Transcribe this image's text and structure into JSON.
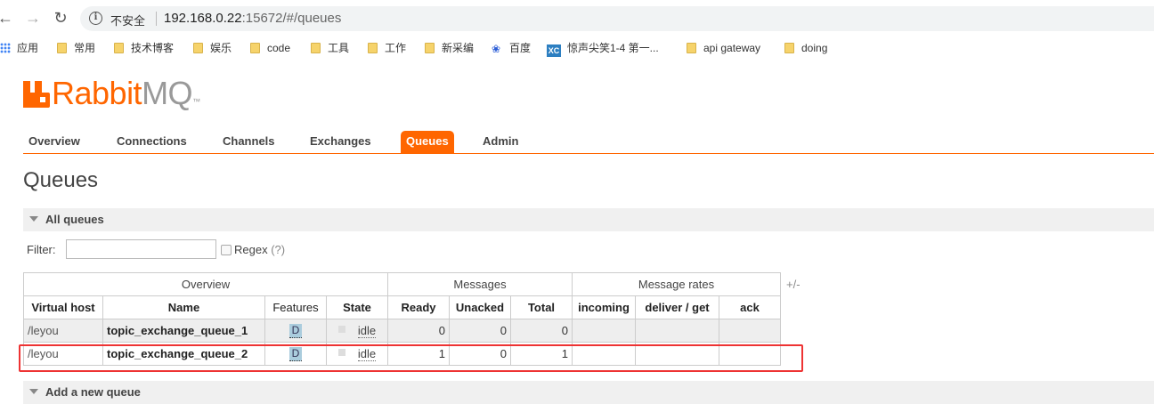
{
  "browser": {
    "insecure_label": "不安全",
    "url_host": "192.168.0.22",
    "url_rest": ":15672/#/queues",
    "bookmarks": [
      {
        "label": "应用",
        "icon": "apps-grid-icon"
      },
      {
        "label": "常用",
        "icon": "folder-icon"
      },
      {
        "label": "技术博客",
        "icon": "folder-icon"
      },
      {
        "label": "娱乐",
        "icon": "folder-icon"
      },
      {
        "label": "code",
        "icon": "folder-icon"
      },
      {
        "label": "工具",
        "icon": "folder-icon"
      },
      {
        "label": "工作",
        "icon": "folder-icon"
      },
      {
        "label": "新采编",
        "icon": "folder-icon"
      },
      {
        "label": "百度",
        "icon": "baidu-paw-icon"
      },
      {
        "label": "惊声尖笑1-4 第一...",
        "icon": "xc-site-icon"
      },
      {
        "label": "api gateway",
        "icon": "folder-icon"
      },
      {
        "label": "doing",
        "icon": "folder-icon"
      }
    ]
  },
  "logo": {
    "rabbit": "Rabbit",
    "mq": "MQ",
    "tm": "™"
  },
  "tabs": [
    "Overview",
    "Connections",
    "Channels",
    "Exchanges",
    "Queues",
    "Admin"
  ],
  "active_tab": "Queues",
  "page_title": "Queues",
  "sections": {
    "all_queues": "All queues",
    "add_queue": "Add a new queue"
  },
  "filter": {
    "label": "Filter:",
    "value": "",
    "regex_label": "Regex",
    "regex_help": "(?)"
  },
  "table": {
    "groups": [
      "Overview",
      "Messages",
      "Message rates"
    ],
    "columns": [
      "Virtual host",
      "Name",
      "Features",
      "State",
      "Ready",
      "Unacked",
      "Total",
      "incoming",
      "deliver / get",
      "ack"
    ],
    "plus_minus": "+/-",
    "rows": [
      {
        "vhost": "/leyou",
        "name": "topic_exchange_queue_1",
        "feature": "D",
        "state": "idle",
        "ready": "0",
        "unacked": "0",
        "total": "0",
        "incoming": "",
        "deliver_get": "",
        "ack": ""
      },
      {
        "vhost": "/leyou",
        "name": "topic_exchange_queue_2",
        "feature": "D",
        "state": "idle",
        "ready": "1",
        "unacked": "0",
        "total": "1",
        "incoming": "",
        "deliver_get": "",
        "ack": ""
      }
    ]
  },
  "colors": {
    "brand": "#ff6600",
    "highlight_box": "#ee3333"
  }
}
